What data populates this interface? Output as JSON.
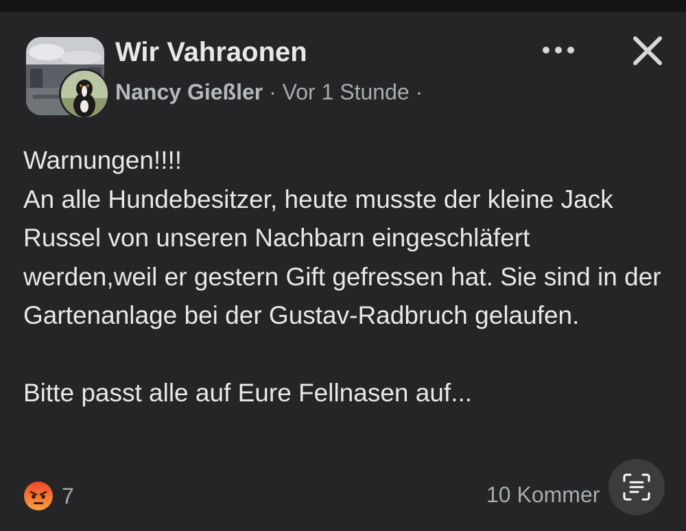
{
  "post": {
    "group_name": "Wir Vahraonen",
    "author": "Nancy Gießler",
    "separator": " · ",
    "time": "Vor 1 Stunde",
    "trailing_separator": " ·",
    "body": {
      "line1": "Warnungen!!!!",
      "line2": "An alle Hundebesitzer, heute musste der kleine Jack Russel von unseren Nachbarn eingeschläfert werden,weil er gestern Gift gefressen hat. Sie sind in der Gartenanlage bei der Gustav-Radbruch gelaufen.",
      "line3": "Bitte passt alle auf Eure Fellnasen auf..."
    }
  },
  "footer": {
    "reaction_icon": "angry-emoji",
    "reaction_count": "7",
    "comments_label": "10 Kommer"
  },
  "icons": {
    "more": "more-horizontal-icon",
    "close": "close-icon",
    "scan": "text-scan-icon"
  },
  "colors": {
    "background": "#252527",
    "text": "#e8e8ea",
    "secondary_text": "#a8abb0",
    "angry_emoji": "#f5743a"
  }
}
